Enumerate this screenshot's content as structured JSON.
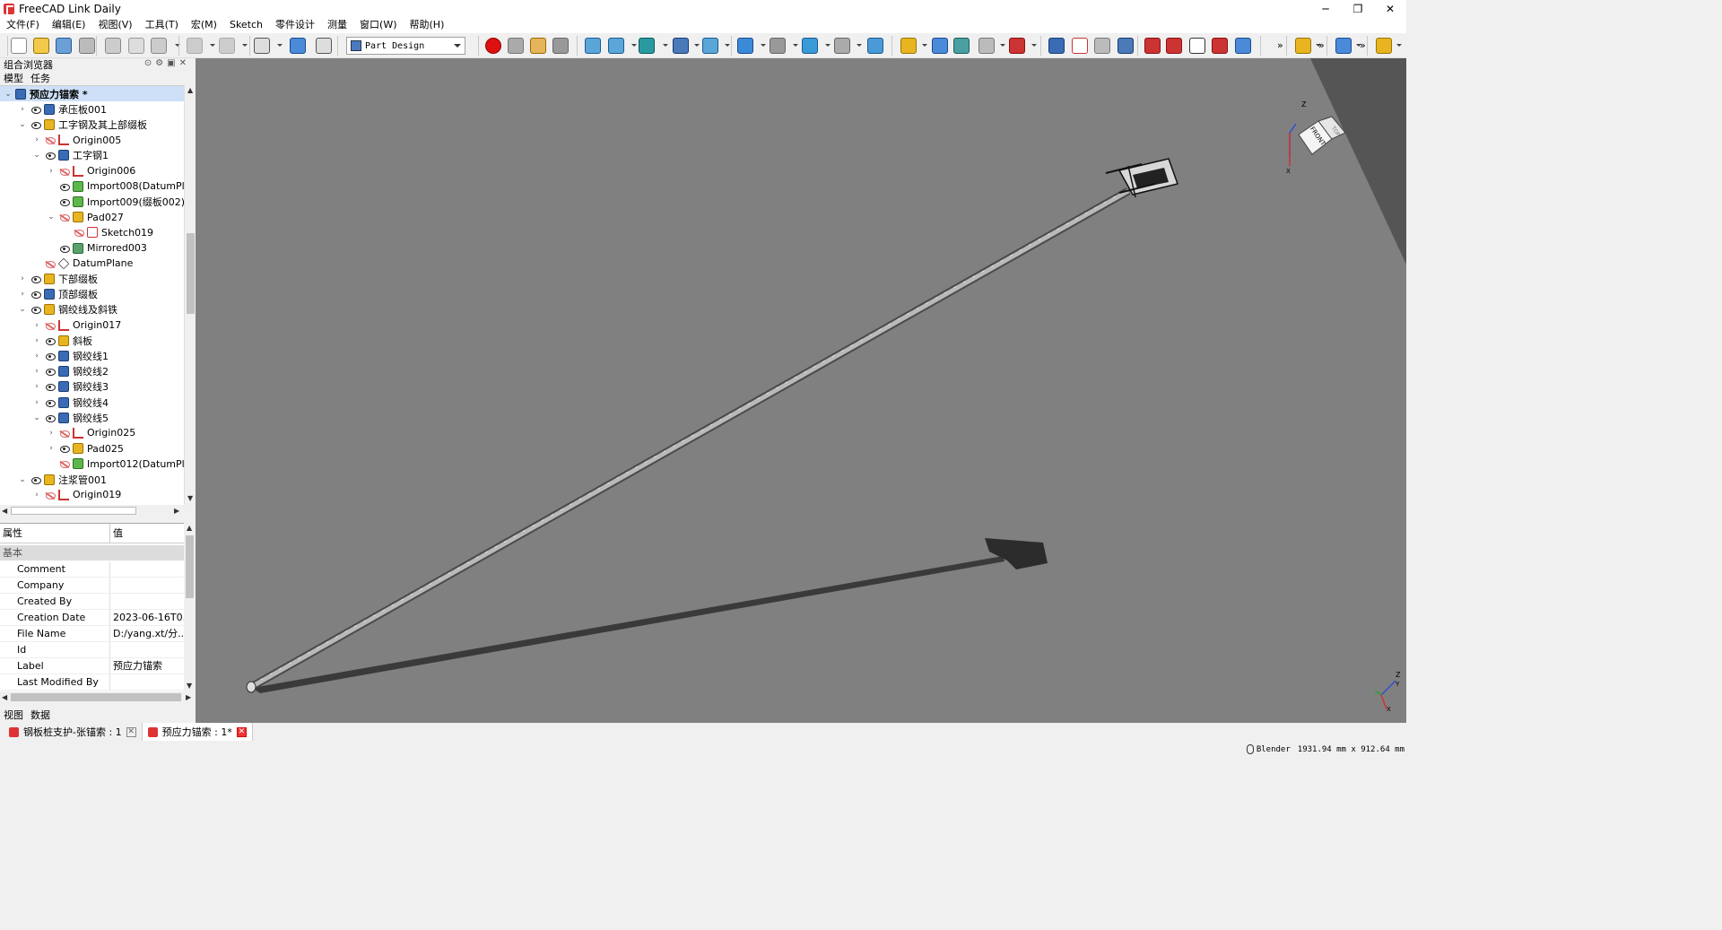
{
  "window": {
    "title": "FreeCAD Link Daily",
    "btn_min": "─",
    "btn_max": "❐",
    "btn_close": "✕"
  },
  "menu": [
    "文件(F)",
    "编辑(E)",
    "视图(V)",
    "工具(T)",
    "宏(M)",
    "Sketch",
    "零件设计",
    "测量",
    "窗口(W)",
    "帮助(H)"
  ],
  "toolbar": {
    "workbench": "Part Design",
    "overflow": "»"
  },
  "combo_view": {
    "title": "组合浏览器",
    "tabs": [
      "模型",
      "任务"
    ],
    "header_icons": "⊙⚙▣✕"
  },
  "tree": [
    {
      "label": "预应力锚索 *",
      "depth": 0,
      "exp": "v",
      "eye": "",
      "icon": "doc",
      "selected": true
    },
    {
      "label": "承压板001",
      "depth": 1,
      "exp": ">",
      "eye": "on",
      "icon": "body"
    },
    {
      "label": "工字钢及其上部缀板",
      "depth": 1,
      "exp": "v",
      "eye": "on",
      "icon": "part"
    },
    {
      "label": "Origin005",
      "depth": 2,
      "exp": ">",
      "eye": "off",
      "icon": "origin"
    },
    {
      "label": "工字钢1",
      "depth": 2,
      "exp": "v",
      "eye": "on",
      "icon": "body"
    },
    {
      "label": "Origin006",
      "depth": 3,
      "exp": ">",
      "eye": "off",
      "icon": "origin"
    },
    {
      "label": "Import008(DatumPlane",
      "depth": 3,
      "exp": "",
      "eye": "on",
      "icon": "datum"
    },
    {
      "label": "Import009(缀板002)",
      "depth": 3,
      "exp": "",
      "eye": "on",
      "icon": "datum"
    },
    {
      "label": "Pad027",
      "depth": 3,
      "exp": "v",
      "eye": "off",
      "icon": "pad"
    },
    {
      "label": "Sketch019",
      "depth": 4,
      "exp": "",
      "eye": "off",
      "icon": "sketch"
    },
    {
      "label": "Mirrored003",
      "depth": 3,
      "exp": "",
      "eye": "on",
      "icon": "mirror"
    },
    {
      "label": "DatumPlane",
      "depth": 2,
      "exp": "",
      "eye": "off",
      "icon": "plane"
    },
    {
      "label": "下部缀板",
      "depth": 1,
      "exp": ">",
      "eye": "on",
      "icon": "part"
    },
    {
      "label": "顶部缀板",
      "depth": 1,
      "exp": ">",
      "eye": "on",
      "icon": "body"
    },
    {
      "label": "钢绞线及斜铁",
      "depth": 1,
      "exp": "v",
      "eye": "on",
      "icon": "part"
    },
    {
      "label": "Origin017",
      "depth": 2,
      "exp": ">",
      "eye": "off",
      "icon": "origin"
    },
    {
      "label": "斜板",
      "depth": 2,
      "exp": ">",
      "eye": "on",
      "icon": "part"
    },
    {
      "label": "钢绞线1",
      "depth": 2,
      "exp": ">",
      "eye": "on",
      "icon": "body"
    },
    {
      "label": "钢绞线2",
      "depth": 2,
      "exp": ">",
      "eye": "on",
      "icon": "body"
    },
    {
      "label": "钢绞线3",
      "depth": 2,
      "exp": ">",
      "eye": "on",
      "icon": "body"
    },
    {
      "label": "钢绞线4",
      "depth": 2,
      "exp": ">",
      "eye": "on",
      "icon": "body"
    },
    {
      "label": "钢绞线5",
      "depth": 2,
      "exp": "v",
      "eye": "on",
      "icon": "body"
    },
    {
      "label": "Origin025",
      "depth": 3,
      "exp": ">",
      "eye": "off",
      "icon": "origin"
    },
    {
      "label": "Pad025",
      "depth": 3,
      "exp": ">",
      "eye": "on",
      "icon": "pad"
    },
    {
      "label": "Import012(DatumPlane",
      "depth": 3,
      "exp": "",
      "eye": "off",
      "icon": "datum"
    },
    {
      "label": "注浆管001",
      "depth": 1,
      "exp": "v",
      "eye": "on",
      "icon": "part"
    },
    {
      "label": "Origin019",
      "depth": 2,
      "exp": ">",
      "eye": "off",
      "icon": "origin"
    }
  ],
  "properties": {
    "col_name": "属性",
    "col_value": "值",
    "group": "基本",
    "rows": [
      {
        "name": "Comment",
        "value": ""
      },
      {
        "name": "Company",
        "value": ""
      },
      {
        "name": "Created By",
        "value": ""
      },
      {
        "name": "Creation Date",
        "value": "2023-06-16T0..."
      },
      {
        "name": "File Name",
        "value": "D:/yang.xt/分..."
      },
      {
        "name": "Id",
        "value": ""
      },
      {
        "name": "Label",
        "value": "预应力锚索"
      },
      {
        "name": "Last Modified By",
        "value": ""
      }
    ]
  },
  "bottom_tabs": [
    "视图",
    "数据"
  ],
  "nav_cube": {
    "face_front": "FRONT",
    "face_side": "TOP",
    "axis_z": "Z",
    "axis_x": "X"
  },
  "axis_triad": {
    "z": "Z",
    "y": "Y",
    "x": "X"
  },
  "doc_tabs": [
    {
      "label": "钢板桩支护-张锚索 : 1",
      "active": false,
      "close": "✕"
    },
    {
      "label": "预应力锚索 : 1*",
      "active": true,
      "close": "✕"
    }
  ],
  "status": {
    "nav_style": "Blender",
    "dimensions": "1931.94 mm x 912.64 mm"
  }
}
